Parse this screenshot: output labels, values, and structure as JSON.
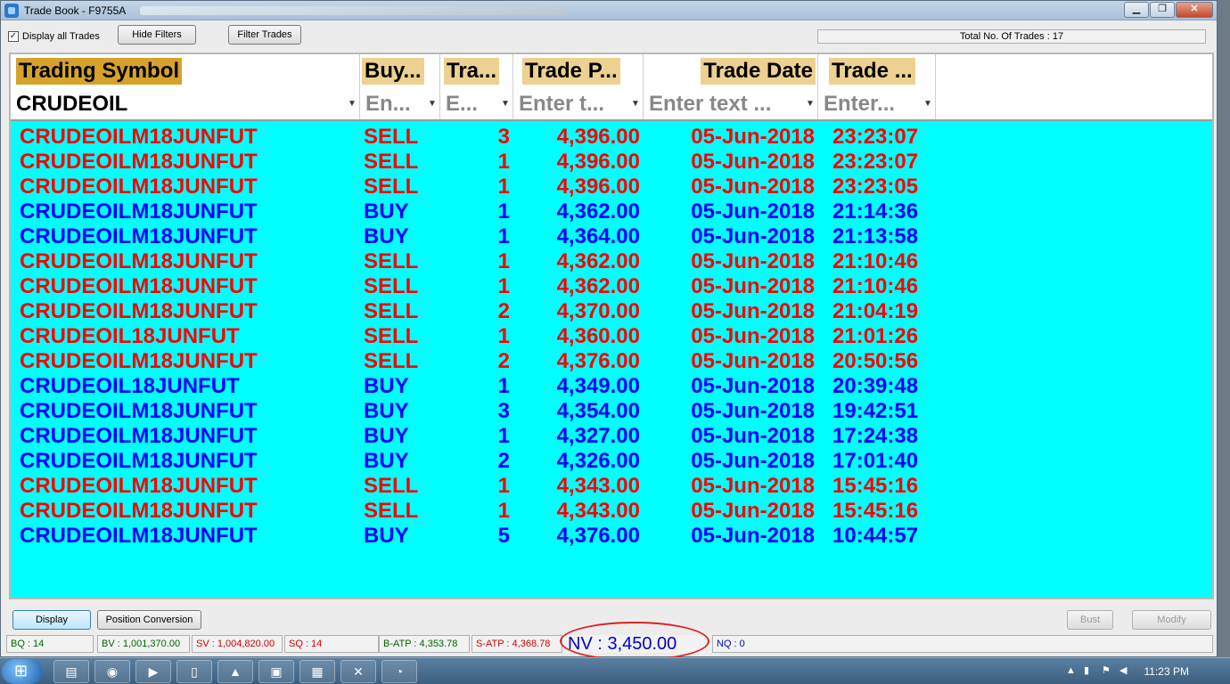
{
  "window": {
    "title": "Trade Book - F9755A"
  },
  "toolbar": {
    "display_all_label": "Display all Trades",
    "display_all_checked": true,
    "hide_filters_label": "Hide Filters",
    "filter_trades_label": "Filter Trades",
    "total_trades": "Total No. Of Trades : 17"
  },
  "columns": [
    {
      "label": "Trading Symbol",
      "filter": "CRUDEOIL",
      "filter_is_placeholder": false
    },
    {
      "label": "Buy...",
      "filter": "En...",
      "filter_is_placeholder": true
    },
    {
      "label": "Tra...",
      "filter": "E...",
      "filter_is_placeholder": true
    },
    {
      "label": "Trade P...",
      "filter": "Enter t...",
      "filter_is_placeholder": true
    },
    {
      "label": "Trade Date",
      "filter": "Enter text ...",
      "filter_is_placeholder": true
    },
    {
      "label": "Trade ...",
      "filter": "Enter...",
      "filter_is_placeholder": true
    }
  ],
  "colors": {
    "sell": "#ff0000",
    "buy": "#0000ff",
    "grid_bg": "#00ffff",
    "header_bg": "#ecd191"
  },
  "trades": [
    {
      "symbol": "CRUDEOILM18JUNFUT",
      "side": "SELL",
      "qty": "3",
      "price": "4,396.00",
      "date": "05-Jun-2018",
      "time": "23:23:07"
    },
    {
      "symbol": "CRUDEOILM18JUNFUT",
      "side": "SELL",
      "qty": "1",
      "price": "4,396.00",
      "date": "05-Jun-2018",
      "time": "23:23:07"
    },
    {
      "symbol": "CRUDEOILM18JUNFUT",
      "side": "SELL",
      "qty": "1",
      "price": "4,396.00",
      "date": "05-Jun-2018",
      "time": "23:23:05"
    },
    {
      "symbol": "CRUDEOILM18JUNFUT",
      "side": "BUY",
      "qty": "1",
      "price": "4,362.00",
      "date": "05-Jun-2018",
      "time": "21:14:36"
    },
    {
      "symbol": "CRUDEOILM18JUNFUT",
      "side": "BUY",
      "qty": "1",
      "price": "4,364.00",
      "date": "05-Jun-2018",
      "time": "21:13:58"
    },
    {
      "symbol": "CRUDEOILM18JUNFUT",
      "side": "SELL",
      "qty": "1",
      "price": "4,362.00",
      "date": "05-Jun-2018",
      "time": "21:10:46"
    },
    {
      "symbol": "CRUDEOILM18JUNFUT",
      "side": "SELL",
      "qty": "1",
      "price": "4,362.00",
      "date": "05-Jun-2018",
      "time": "21:10:46"
    },
    {
      "symbol": "CRUDEOILM18JUNFUT",
      "side": "SELL",
      "qty": "2",
      "price": "4,370.00",
      "date": "05-Jun-2018",
      "time": "21:04:19"
    },
    {
      "symbol": "CRUDEOIL18JUNFUT",
      "side": "SELL",
      "qty": "1",
      "price": "4,360.00",
      "date": "05-Jun-2018",
      "time": "21:01:26"
    },
    {
      "symbol": "CRUDEOILM18JUNFUT",
      "side": "SELL",
      "qty": "2",
      "price": "4,376.00",
      "date": "05-Jun-2018",
      "time": "20:50:56"
    },
    {
      "symbol": "CRUDEOIL18JUNFUT",
      "side": "BUY",
      "qty": "1",
      "price": "4,349.00",
      "date": "05-Jun-2018",
      "time": "20:39:48"
    },
    {
      "symbol": "CRUDEOILM18JUNFUT",
      "side": "BUY",
      "qty": "3",
      "price": "4,354.00",
      "date": "05-Jun-2018",
      "time": "19:42:51"
    },
    {
      "symbol": "CRUDEOILM18JUNFUT",
      "side": "BUY",
      "qty": "1",
      "price": "4,327.00",
      "date": "05-Jun-2018",
      "time": "17:24:38"
    },
    {
      "symbol": "CRUDEOILM18JUNFUT",
      "side": "BUY",
      "qty": "2",
      "price": "4,326.00",
      "date": "05-Jun-2018",
      "time": "17:01:40"
    },
    {
      "symbol": "CRUDEOILM18JUNFUT",
      "side": "SELL",
      "qty": "1",
      "price": "4,343.00",
      "date": "05-Jun-2018",
      "time": "15:45:16"
    },
    {
      "symbol": "CRUDEOILM18JUNFUT",
      "side": "SELL",
      "qty": "1",
      "price": "4,343.00",
      "date": "05-Jun-2018",
      "time": "15:45:16"
    },
    {
      "symbol": "CRUDEOILM18JUNFUT",
      "side": "BUY",
      "qty": "5",
      "price": "4,376.00",
      "date": "05-Jun-2018",
      "time": "10:44:57"
    }
  ],
  "bottom": {
    "display_label": "Display",
    "position_conversion_label": "Position Conversion",
    "bust_label": "Bust",
    "modify_label": "Modify"
  },
  "status": {
    "bq": "BQ : 14",
    "bv": "BV : 1,001,370.00",
    "sv": "SV : 1,004,820.00",
    "sq": "SQ : 14",
    "batp": "B-ATP : 4,353.78",
    "satp": "S-ATP : 4,368.78",
    "nv": "NV : 3,450.00",
    "nq": "NQ : 0"
  },
  "taskbar": {
    "clock": "11:23 PM"
  }
}
